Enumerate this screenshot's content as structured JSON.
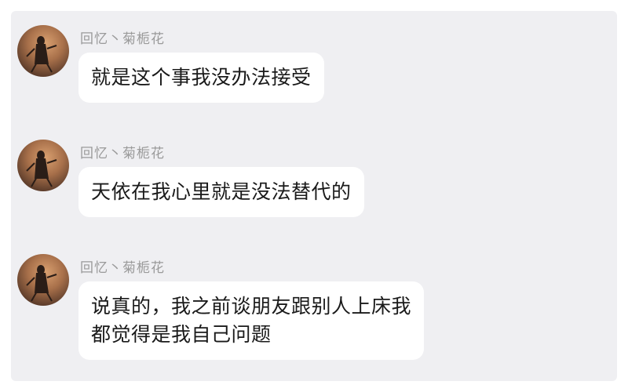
{
  "messages": [
    {
      "sender": "回忆丶菊栀花",
      "lines": [
        "就是这个事我没办法接受"
      ]
    },
    {
      "sender": "回忆丶菊栀花",
      "lines": [
        "天依在我心里就是没法替代的"
      ]
    },
    {
      "sender": "回忆丶菊栀花",
      "lines": [
        "说真的，我之前谈朋友跟别人上床我",
        "都觉得是我自己问题"
      ]
    }
  ]
}
